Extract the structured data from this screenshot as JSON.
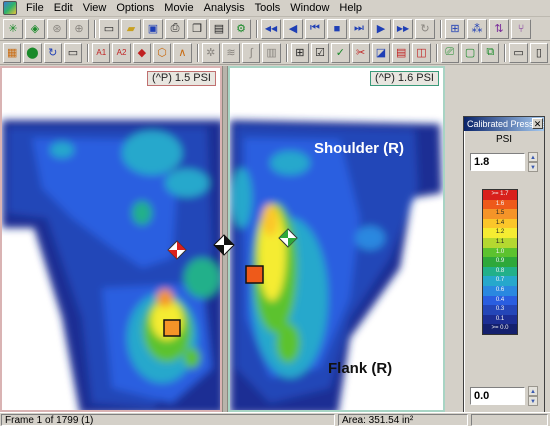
{
  "menu": [
    "File",
    "Edit",
    "View",
    "Options",
    "Movie",
    "Analysis",
    "Tools",
    "Window",
    "Help"
  ],
  "toolbar_row1": [
    {
      "name": "snowflake",
      "glyph": "✳",
      "color": "#1a8a2a"
    },
    {
      "name": "sensor-group",
      "glyph": "◈",
      "color": "#1a8a2a"
    },
    {
      "name": "scan",
      "glyph": "⊛",
      "color": "#8a8680"
    },
    {
      "name": "zoom",
      "glyph": "⊕",
      "color": "#8a8680"
    },
    {
      "name": "document",
      "glyph": "▭",
      "color": "#222"
    },
    {
      "name": "open-folder",
      "glyph": "▰",
      "color": "#c8a020"
    },
    {
      "name": "save",
      "glyph": "▣",
      "color": "#1f3fb5"
    },
    {
      "name": "print",
      "glyph": "⎙",
      "color": "#222"
    },
    {
      "name": "copy",
      "glyph": "❐",
      "color": "#222"
    },
    {
      "name": "paste",
      "glyph": "▤",
      "color": "#222"
    },
    {
      "name": "recorder",
      "glyph": "⚙",
      "color": "#1a8a2a"
    },
    {
      "name": "rewind",
      "glyph": "◀◀",
      "color": "#1f3fb5"
    },
    {
      "name": "step-back",
      "glyph": "◀",
      "color": "#1f3fb5"
    },
    {
      "name": "first-frame",
      "glyph": "⏮",
      "color": "#1f3fb5"
    },
    {
      "name": "stop",
      "glyph": "■",
      "color": "#1f3fb5"
    },
    {
      "name": "last-frame",
      "glyph": "⏭",
      "color": "#1f3fb5"
    },
    {
      "name": "play",
      "glyph": "▶",
      "color": "#1f3fb5"
    },
    {
      "name": "fast-forward",
      "glyph": "▶▶",
      "color": "#1f3fb5"
    },
    {
      "name": "loop",
      "glyph": "↻",
      "color": "#8a8680"
    },
    {
      "name": "graph",
      "glyph": "⊞",
      "color": "#1f3fb5"
    },
    {
      "name": "nodes",
      "glyph": "⁂",
      "color": "#1f3fb5"
    },
    {
      "name": "flow",
      "glyph": "⇅",
      "color": "#7a2a9a"
    },
    {
      "name": "fork",
      "glyph": "⑂",
      "color": "#7a2a9a"
    }
  ],
  "toolbar_row2": [
    {
      "name": "grid",
      "glyph": "▦",
      "color": "#c86a10"
    },
    {
      "name": "pressure-map",
      "glyph": "⬤",
      "color": "#1a8a2a"
    },
    {
      "name": "refresh",
      "glyph": "↻",
      "color": "#1f3fb5"
    },
    {
      "name": "window",
      "glyph": "▭",
      "color": "#222"
    },
    {
      "name": "avg-1",
      "glyph": "A1",
      "color": "#c02020"
    },
    {
      "name": "avg-2",
      "glyph": "A2",
      "color": "#c02020"
    },
    {
      "name": "peak",
      "glyph": "◆",
      "color": "#c02020"
    },
    {
      "name": "center-of-force",
      "glyph": "⬡",
      "color": "#c86a10"
    },
    {
      "name": "angle",
      "glyph": "∧",
      "color": "#c86a10"
    },
    {
      "name": "sparkle",
      "glyph": "✲",
      "color": "#8a8680"
    },
    {
      "name": "waves",
      "glyph": "≋",
      "color": "#8a8680"
    },
    {
      "name": "integral",
      "glyph": "∫",
      "color": "#8a8680"
    },
    {
      "name": "bars",
      "glyph": "▥",
      "color": "#8a8680"
    },
    {
      "name": "box-select",
      "glyph": "⊞",
      "color": "#222"
    },
    {
      "name": "checkbox",
      "glyph": "☑",
      "color": "#222"
    },
    {
      "name": "check",
      "glyph": "✓",
      "color": "#1a8a2a"
    },
    {
      "name": "cut",
      "glyph": "✂",
      "color": "#c02020"
    },
    {
      "name": "region",
      "glyph": "◪",
      "color": "#1f3fb5"
    },
    {
      "name": "stacks",
      "glyph": "▤",
      "color": "#c02020"
    },
    {
      "name": "plot",
      "glyph": "◫",
      "color": "#c02020"
    },
    {
      "name": "camera",
      "glyph": "⎚",
      "color": "#1a8a2a"
    },
    {
      "name": "film",
      "glyph": "▢",
      "color": "#1a8a2a"
    },
    {
      "name": "slides",
      "glyph": "⧉",
      "color": "#1a8a2a"
    },
    {
      "name": "split-horizontal",
      "glyph": "▭",
      "color": "#222"
    },
    {
      "name": "split-vertical",
      "glyph": "▯",
      "color": "#222"
    }
  ],
  "left_pane": {
    "label": "(^P) 1.5 PSI"
  },
  "right_pane": {
    "label": "(^P) 1.6 PSI",
    "annotation_top": "Shoulder (R)",
    "annotation_bottom": "Flank (R)"
  },
  "calibration": {
    "title": "Calibrated Pressure",
    "units": "PSI",
    "max_value": "1.8",
    "min_value": "0.0",
    "legend": [
      {
        "label": ">= 1.7",
        "color": "#d8201c"
      },
      {
        "label": "1.6",
        "color": "#ee5a1a"
      },
      {
        "label": "1.5",
        "color": "#f59428"
      },
      {
        "label": "1.4",
        "color": "#fbc62a"
      },
      {
        "label": "1.2",
        "color": "#f5ec32"
      },
      {
        "label": "1.1",
        "color": "#b4d830"
      },
      {
        "label": "1.0",
        "color": "#5cc22e"
      },
      {
        "label": "0.9",
        "color": "#2ea83a"
      },
      {
        "label": "0.8",
        "color": "#22b08a"
      },
      {
        "label": "0.7",
        "color": "#26a8cc"
      },
      {
        "label": "0.6",
        "color": "#2a88e0"
      },
      {
        "label": "0.4",
        "color": "#2a5ee0"
      },
      {
        "label": "0.3",
        "color": "#2446b8"
      },
      {
        "label": "0.1",
        "color": "#1c2e94"
      },
      {
        "label": ">= 0.0",
        "color": "#14206e"
      }
    ]
  },
  "status": {
    "frame": "Frame 1 of 1799 (1)",
    "area": "Area: 351.54 in²"
  }
}
